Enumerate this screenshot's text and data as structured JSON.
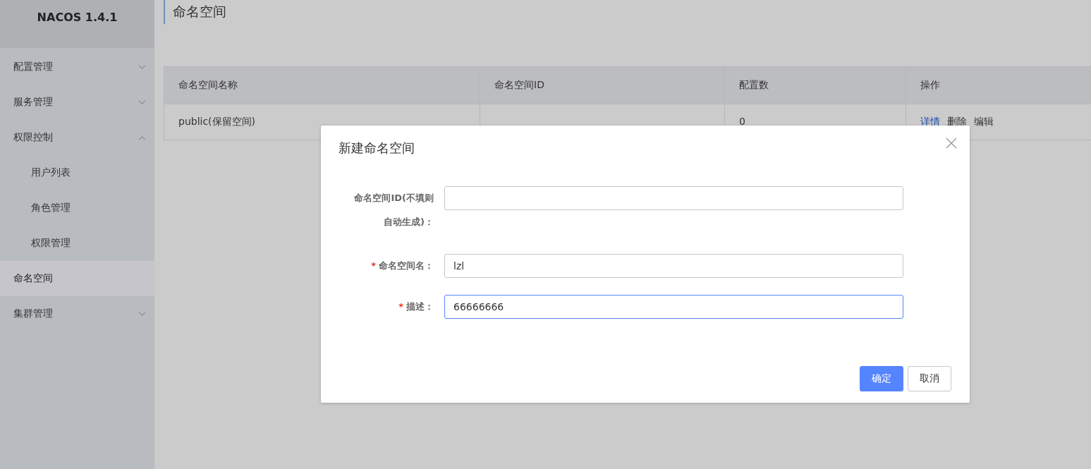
{
  "sidebar": {
    "title": "NACOS 1.4.1",
    "items": [
      {
        "label": "配置管理",
        "expanded": false,
        "selected": false
      },
      {
        "label": "服务管理",
        "expanded": false,
        "selected": false
      },
      {
        "label": "权限控制",
        "expanded": true,
        "selected": false,
        "children": [
          {
            "label": "用户列表",
            "selected": false
          },
          {
            "label": "角色管理",
            "selected": false
          },
          {
            "label": "权限管理",
            "selected": false
          }
        ]
      },
      {
        "label": "命名空间",
        "selected": true
      },
      {
        "label": "集群管理",
        "expanded": false,
        "selected": false
      }
    ]
  },
  "page": {
    "title": "命名空间"
  },
  "table": {
    "columns": [
      "命名空间名称",
      "命名空间ID",
      "配置数",
      "操作"
    ],
    "rows": [
      {
        "name": "public(保留空间)",
        "config_count": "0",
        "actions": [
          {
            "label": "详情",
            "color": "#1f4fa8"
          },
          {
            "label": "删除",
            "color": "#333333"
          },
          {
            "label": "编辑",
            "color": "#333333"
          }
        ]
      }
    ]
  },
  "dialog": {
    "title": "新建命名空间",
    "fields": [
      {
        "label": "命名空间ID(不填则自动生成)：",
        "focused": false
      },
      {
        "label": "命名空间名：",
        "required_mark": "*",
        "value": "lzl",
        "focused": false
      },
      {
        "label": "描述：",
        "required_mark": "*",
        "value": "66666666",
        "focused": true
      }
    ],
    "buttons": [
      {
        "label": "确定",
        "kind": "primary"
      },
      {
        "label": "取消",
        "kind": "normal"
      }
    ]
  }
}
